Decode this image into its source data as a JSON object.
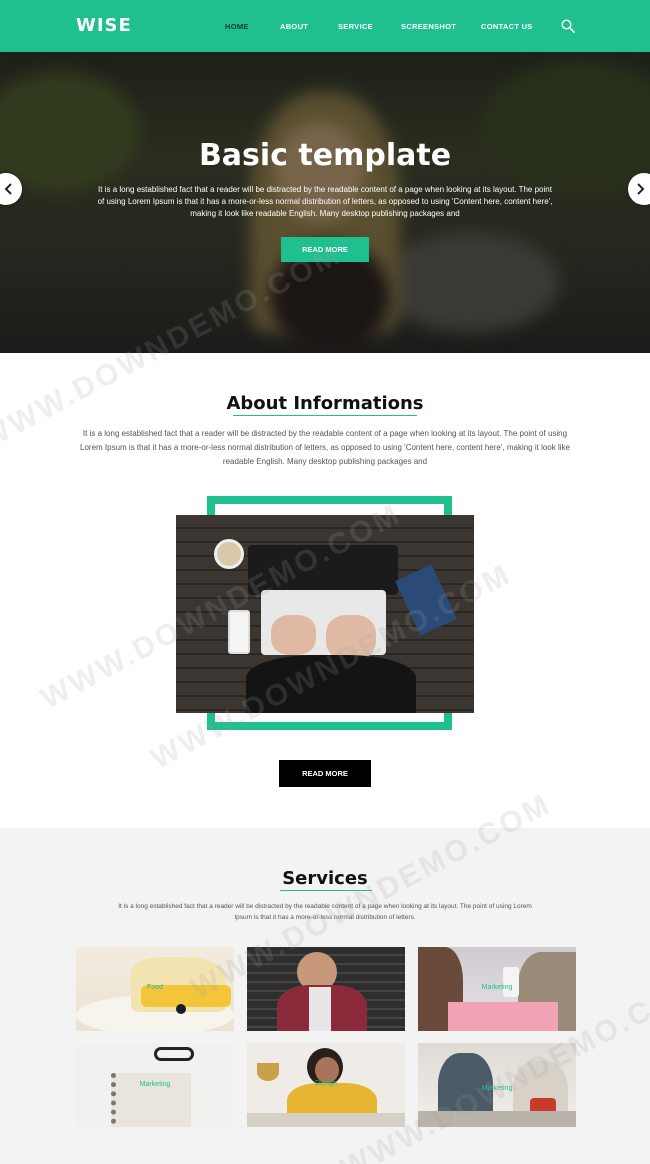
{
  "header": {
    "brand": "WISE",
    "nav": [
      {
        "label": "HOME",
        "active": true
      },
      {
        "label": "ABOUT",
        "active": false
      },
      {
        "label": "SERVICE",
        "active": false
      },
      {
        "label": "SCREENSHOT",
        "active": false
      },
      {
        "label": "CONTACT US",
        "active": false
      }
    ],
    "search_icon": "search-icon"
  },
  "hero": {
    "title": "Basic template",
    "text": "It is a long established fact that a reader will be distracted by the readable content of a page when looking at its layout. The point of using Lorem Ipsum is that it has a more-or-less normal distribution of letters, as opposed to using 'Content here, content here', making it look like readable English. Many desktop publishing packages and",
    "button": "READ MORE",
    "prev_icon": "chevron-left-icon",
    "next_icon": "chevron-right-icon"
  },
  "about": {
    "title": "About Informations",
    "text": "It is a long established fact that a reader will be distracted by the readable content of a page when looking at its layout. The point of using Lorem Ipsum is that it has a more-or-less normal distribution of letters, as opposed to using 'Content here, content here', making it look like readable English. Many desktop publishing packages and",
    "button": "READ MORE"
  },
  "services": {
    "title": "Services",
    "text": "It is a long established fact that a reader will be distracted by the readable content of a page when looking at its layout. The point of using Lorem Ipsum is that it has a more-or-less normal distribution of letters.",
    "cards": [
      {
        "label": "Food"
      },
      {
        "label": ""
      },
      {
        "label": "Marketing"
      },
      {
        "label": "Marketing"
      },
      {
        "label": "Design"
      },
      {
        "label": "Marketing"
      }
    ]
  },
  "watermark": "WWW.DOWNDEMO.COM",
  "colors": {
    "accent": "#1fbf8f",
    "dark": "#000000",
    "services_bg": "#f3f3f3"
  }
}
